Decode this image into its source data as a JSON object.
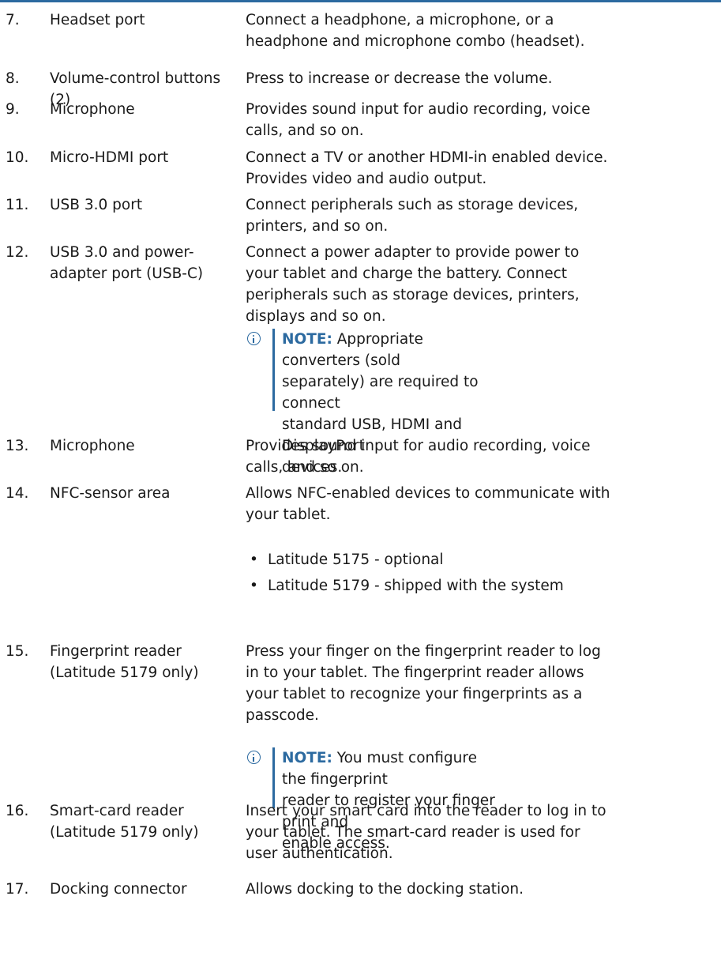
{
  "rows": [
    {
      "num": "7.",
      "name": "Headset port",
      "desc": "Connect a headphone, a microphone, or a\nheadphone and microphone combo (headset)."
    },
    {
      "num": "8.",
      "name": "Volume-control buttons (2)",
      "desc": "Press to increase or decrease the volume."
    },
    {
      "num": "9.",
      "name": "Microphone",
      "desc": "Provides sound input for audio recording, voice\ncalls, and so on."
    },
    {
      "num": "10.",
      "name": "Micro-HDMI port",
      "desc": "Connect a TV or another HDMI-in enabled device.\nProvides video and audio output."
    },
    {
      "num": "11.",
      "name": "USB 3.0 port",
      "desc": "Connect peripherals such as storage devices,\nprinters, and so on."
    },
    {
      "num": "12.",
      "name": "USB 3.0 and power-\nadapter port (USB-C)",
      "desc": "Connect a power adapter to provide power to\nyour tablet and charge the battery. Connect\nperipherals such as storage devices, printers,\ndisplays and so on.",
      "note": {
        "label": "NOTE:",
        "text": "Appropriate converters (sold\nseparately) are required to connect\nstandard USB, HDMI and DisplayPort\ndevices."
      }
    },
    {
      "num": "13.",
      "name": "Microphone",
      "desc": "Provides sound input for audio recording, voice\ncalls, and so on."
    },
    {
      "num": "14.",
      "name": "NFC-sensor area",
      "desc": "Allows NFC-enabled devices to communicate with\nyour tablet.",
      "bullets": [
        "Latitude 5175 - optional",
        "Latitude 5179 - shipped with the system"
      ]
    },
    {
      "num": "15.",
      "name": "Fingerprint reader\n(Latitude 5179 only)",
      "desc": "Press your finger on the fingerprint reader to log\nin to your tablet. The fingerprint reader allows\nyour tablet to recognize your fingerprints as a\npasscode.",
      "note": {
        "label": "NOTE:",
        "text": "You must configure the fingerprint\nreader to register your finger print and\nenable access."
      }
    },
    {
      "num": "16.",
      "name": "Smart-card reader\n(Latitude 5179 only)",
      "desc": "Insert your smart card into the reader to log in to\nyour tablet. The smart-card reader is used for\nuser authentication."
    },
    {
      "num": "17.",
      "name": "Docking connector",
      "desc": "Allows docking to the docking station."
    }
  ],
  "bullet_symbol": "•",
  "colors": {
    "accent": "#2c6aa0",
    "text": "#1a1a1a"
  },
  "icons": {
    "note": "info-circle-icon"
  }
}
